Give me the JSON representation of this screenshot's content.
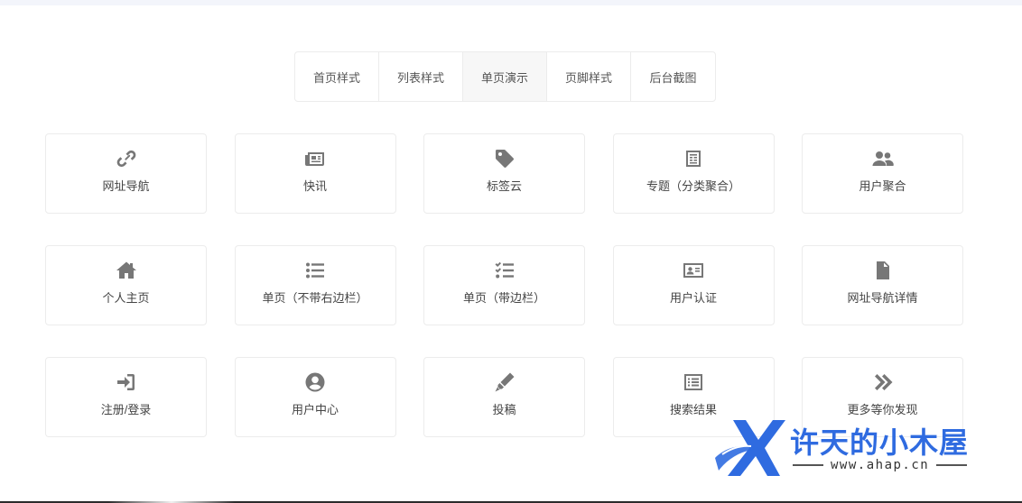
{
  "tabs": [
    {
      "label": "首页样式",
      "active": false
    },
    {
      "label": "列表样式",
      "active": false
    },
    {
      "label": "单页演示",
      "active": true
    },
    {
      "label": "页脚样式",
      "active": false
    },
    {
      "label": "后台截图",
      "active": false
    }
  ],
  "cards": [
    {
      "label": "网址导航",
      "icon": "link-icon"
    },
    {
      "label": "快讯",
      "icon": "newspaper-icon"
    },
    {
      "label": "标签云",
      "icon": "tag-icon"
    },
    {
      "label": "专题（分类聚合）",
      "icon": "topic-board-icon"
    },
    {
      "label": "用户聚合",
      "icon": "users-icon"
    },
    {
      "label": "个人主页",
      "icon": "home-icon"
    },
    {
      "label": "单页（不带右边栏）",
      "icon": "list-icon"
    },
    {
      "label": "单页（带边栏）",
      "icon": "checklist-icon"
    },
    {
      "label": "用户认证",
      "icon": "id-card-icon"
    },
    {
      "label": "网址导航详情",
      "icon": "document-icon"
    },
    {
      "label": "注册/登录",
      "icon": "sign-in-icon"
    },
    {
      "label": "用户中心",
      "icon": "user-circle-icon"
    },
    {
      "label": "投稿",
      "icon": "pen-icon"
    },
    {
      "label": "搜索结果",
      "icon": "list-alt-icon"
    },
    {
      "label": "更多等你发现",
      "icon": "double-chevron-right-icon"
    }
  ],
  "watermark": {
    "brand": "许天的小木屋",
    "domain": "www.ahap.cn"
  },
  "colors": {
    "icon": "#777777",
    "text": "#444444",
    "border": "#ececec",
    "active_tab_bg": "#f7f7f7",
    "brand_blue": "#2f6be0"
  }
}
